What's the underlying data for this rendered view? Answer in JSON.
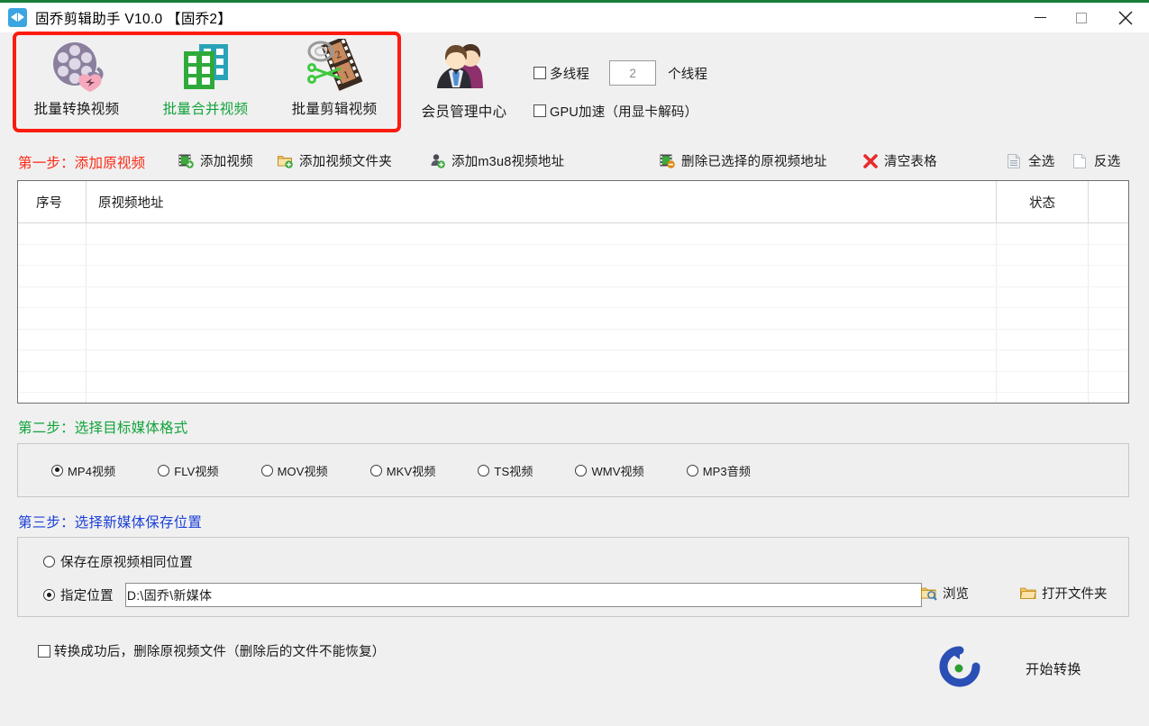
{
  "window": {
    "title": "固乔剪辑助手 V10.0  【固乔2】",
    "app_icon": "video-clip-icon",
    "minimize": "−",
    "maximize": "□",
    "close": "✕",
    "accent_top": "#1a7d3c"
  },
  "toolbar": {
    "highlight_color": "#fb1b0f",
    "buttons": [
      {
        "label": "批量转换视频",
        "icon": "film-reel-icon",
        "active": false
      },
      {
        "label": "批量合并视频",
        "icon": "merge-clips-icon",
        "active": true
      },
      {
        "label": "批量剪辑视频",
        "icon": "scissors-film-icon",
        "active": false
      }
    ],
    "member_center": {
      "label": "会员管理中心",
      "icon": "members-icon"
    },
    "options": {
      "multithread_label": "多线程",
      "multithread_checked": false,
      "thread_count": "2",
      "thread_unit": "个线程",
      "gpu_label": "GPU加速（用显卡解码）",
      "gpu_checked": false
    }
  },
  "step1": {
    "label": "第一步：添加原视频",
    "label_color": "#fb2a16",
    "actions": [
      {
        "label": "添加视频",
        "icon": "add-video-icon"
      },
      {
        "label": "添加视频文件夹",
        "icon": "add-folder-icon"
      },
      {
        "label": "添加m3u8视频地址",
        "icon": "add-m3u8-icon"
      },
      {
        "label": "删除已选择的原视频地址",
        "icon": "remove-video-icon"
      },
      {
        "label": "清空表格",
        "icon": "clear-table-icon"
      },
      {
        "label": "全选",
        "icon": "select-all-icon"
      },
      {
        "label": "反选",
        "icon": "invert-selection-icon"
      }
    ]
  },
  "table": {
    "columns": [
      "序号",
      "原视频地址",
      "状态",
      ""
    ],
    "rows": [],
    "empty_row_count": 9
  },
  "step2": {
    "label": "第二步：选择目标媒体格式",
    "label_color": "#12a33b",
    "formats": [
      {
        "label": "MP4视频",
        "selected": true
      },
      {
        "label": "FLV视频",
        "selected": false
      },
      {
        "label": "MOV视频",
        "selected": false
      },
      {
        "label": "MKV视频",
        "selected": false
      },
      {
        "label": "TS视频",
        "selected": false
      },
      {
        "label": "WMV视频",
        "selected": false
      },
      {
        "label": "MP3音频",
        "selected": false
      }
    ]
  },
  "step3": {
    "label": "第三步：选择新媒体保存位置",
    "label_color": "#1a3fd8",
    "same_location_label": "保存在原视频相同位置",
    "same_location_selected": false,
    "custom_location_label": "指定位置",
    "custom_location_selected": true,
    "path_value": "D:\\固乔\\新媒体",
    "browse_label": "浏览",
    "browse_icon": "browse-folder-icon",
    "open_folder_label": "打开文件夹",
    "open_folder_icon": "open-folder-icon"
  },
  "footer": {
    "delete_source_label": "转换成功后，删除原视频文件（删除后的文件不能恢复）",
    "delete_source_checked": false,
    "start_label": "开始转换",
    "start_icon": "refresh-circle-icon"
  }
}
